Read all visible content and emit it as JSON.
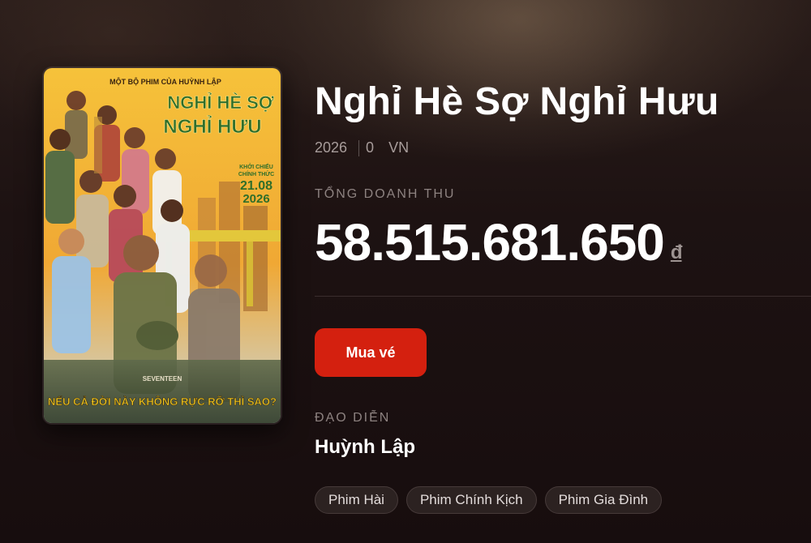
{
  "movie": {
    "title": "Nghỉ Hè Sợ Nghỉ Hưu",
    "year": "2026",
    "rating": "0",
    "country": "VN",
    "revenue_label": "TỔNG DOANH THU",
    "revenue": "58.515.681.650",
    "currency": "đ",
    "buy_label": "Mua vé",
    "director_label": "ĐẠO DIỄN",
    "director": "Huỳnh Lập",
    "genres": [
      "Phim Hài",
      "Phim Chính Kịch",
      "Phim Gia Đình"
    ]
  },
  "poster": {
    "top_line": "MỘT BỘ PHIM CỦA HUỲNH LẬP",
    "title_line1": "NGHỈ HÈ SỢ",
    "title_line2": "NGHỈ HƯU",
    "release_line1": "KHỞI CHIẾU",
    "release_line2": "CHÍNH THỨC",
    "release_date": "21.08",
    "release_year": "2026",
    "tagline": "NẾU CẢ ĐỜI NÀY KHÔNG RỰC RỠ THÌ SAO?",
    "studio": "SEVENTEEN"
  },
  "colors": {
    "accent": "#d4200f",
    "poster_yellow": "#f2b526",
    "poster_green": "#e6d64a"
  }
}
